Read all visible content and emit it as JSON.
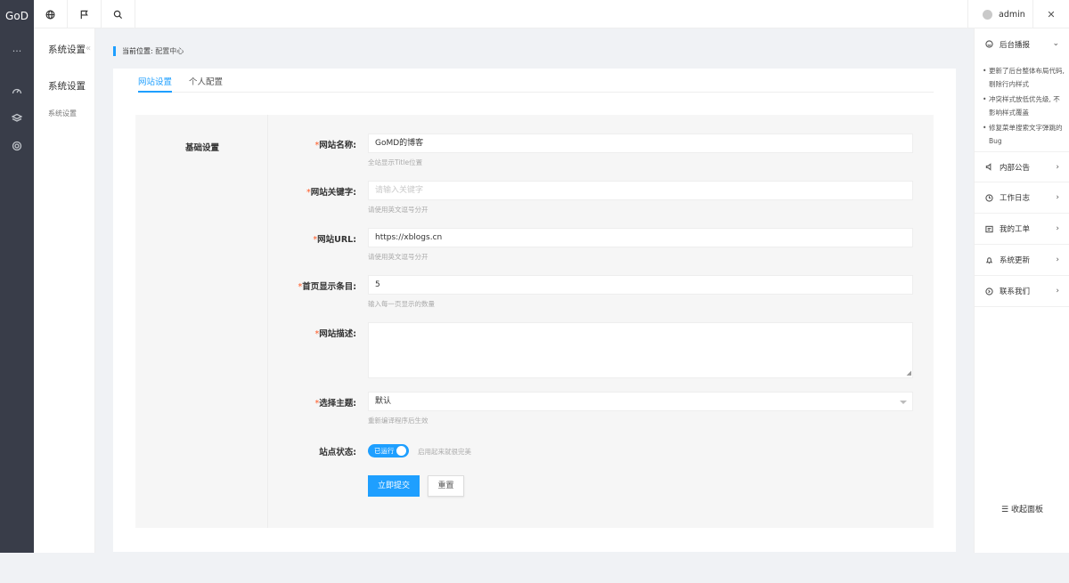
{
  "app": {
    "logo": "GoD"
  },
  "icon_bar": {
    "more": "···"
  },
  "sub_nav": {
    "title": "系统设置",
    "collapse": "«",
    "group": "系统设置",
    "item": "系统设置"
  },
  "topbar": {
    "user": "admin",
    "close": "✕"
  },
  "breadcrumb": {
    "prefix": "当前位置:",
    "current": "配置中心"
  },
  "tabs": [
    {
      "label": "网站设置"
    },
    {
      "label": "个人配置"
    }
  ],
  "form": {
    "section": "基础设置",
    "fields": {
      "site_name": {
        "label": "网站名称:",
        "value": "GoMD的博客",
        "hint": "全站显示Title位置"
      },
      "keywords": {
        "label": "网站关键字:",
        "placeholder": "请输入关键字",
        "hint": "请使用英文逗号分开"
      },
      "url": {
        "label": "网站URL:",
        "value": "https://xblogs.cn",
        "hint": "请使用英文逗号分开"
      },
      "page_size": {
        "label": "首页显示条目:",
        "value": "5",
        "hint": "输入每一页显示的数量"
      },
      "description": {
        "label": "网站描述:",
        "value": ""
      },
      "theme": {
        "label": "选择主题:",
        "value": "默认",
        "hint": "重新编译程序后生效"
      },
      "status": {
        "label": "站点状态:",
        "switch_text": "已运行",
        "on": true,
        "hint": "启用起来就很完美"
      }
    },
    "required_mark": "*",
    "submit": "立即提交",
    "reset": "重置"
  },
  "right_panel": {
    "news_title": "后台播报",
    "news": [
      "更新了后台整体布局代码, 剔除行内样式",
      "冲突样式放低优先级, 不影响样式覆盖",
      "修复菜单搜索文字弹跳的Bug"
    ],
    "items": [
      {
        "label": "内部公告",
        "icon": "speaker-icon"
      },
      {
        "label": "工作日志",
        "icon": "clock-icon"
      },
      {
        "label": "我的工单",
        "icon": "ticket-icon"
      },
      {
        "label": "系统更新",
        "icon": "bell-icon"
      },
      {
        "label": "联系我们",
        "icon": "contact-icon"
      }
    ],
    "collapse": "☰ 收起面板"
  },
  "colors": {
    "accent": "#1e9fff",
    "sidebar": "#393d49",
    "required": "#ff5722"
  }
}
